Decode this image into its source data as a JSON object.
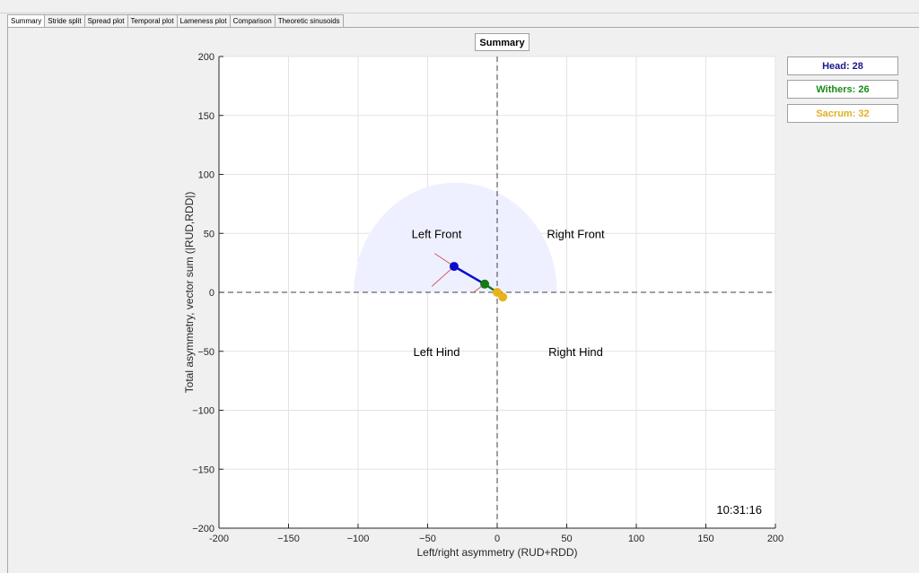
{
  "tabs": [
    {
      "label": "Summary",
      "active": true
    },
    {
      "label": "Stride split",
      "active": false
    },
    {
      "label": "Spread plot",
      "active": false
    },
    {
      "label": "Temporal plot",
      "active": false
    },
    {
      "label": "Lameness plot",
      "active": false
    },
    {
      "label": "Comparison",
      "active": false
    },
    {
      "label": "Theoretic sinusoids",
      "active": false
    }
  ],
  "summary_button": "Summary",
  "legend": [
    {
      "label": "Head: 28",
      "color": "#1a1a8a"
    },
    {
      "label": "Withers: 26",
      "color": "#1a8a1a"
    },
    {
      "label": "Sacrum: 32",
      "color": "#e0b020"
    }
  ],
  "chart_data": {
    "type": "scatter",
    "xlabel": "Left/right asymmetry (RUD+RDD)",
    "ylabel": "Total asymmetry, vector sum (|RUD,RDD|)",
    "xlim": [
      -200,
      200
    ],
    "ylim": [
      -200,
      200
    ],
    "xticks": [
      -200,
      -150,
      -100,
      -50,
      0,
      50,
      100,
      150,
      200
    ],
    "yticks": [
      -200,
      -150,
      -100,
      -50,
      0,
      50,
      100,
      150,
      200
    ],
    "xtick_labels": [
      "-200",
      "−150",
      "−100",
      "−50",
      "0",
      "50",
      "100",
      "150",
      "200"
    ],
    "ytick_labels": [
      "−200",
      "−150",
      "−100",
      "−50",
      "0",
      "50",
      "100",
      "150",
      "200"
    ],
    "grid": true,
    "quadrant_labels": [
      {
        "text": "Left Front",
        "x": -50,
        "y": 50
      },
      {
        "text": "Right Front",
        "x": 50,
        "y": 50
      },
      {
        "text": "Left Hind",
        "x": -50,
        "y": -50
      },
      {
        "text": "Right Hind",
        "x": 50,
        "y": -50
      }
    ],
    "timestamp": "10:31:16",
    "region": {
      "cx": -30,
      "cy": 0,
      "rx": 73,
      "ry": 93
    },
    "series": [
      {
        "name": "Head",
        "color": "#0d0dc8",
        "segment": [
          [
            -9,
            7
          ],
          [
            -31,
            22
          ]
        ],
        "point": [
          -31,
          22
        ]
      },
      {
        "name": "Withers",
        "color": "#137a13",
        "segment": [
          [
            0,
            0
          ],
          [
            -9,
            7
          ]
        ],
        "point": [
          -9,
          7
        ]
      },
      {
        "name": "Sacrum",
        "color": "#e8b21a",
        "segment": [
          [
            0,
            0
          ],
          [
            4,
            -4
          ]
        ],
        "point": [
          4,
          -4
        ]
      }
    ],
    "markers": [
      {
        "color": "#d06060",
        "from": [
          -31,
          22
        ],
        "to": [
          -45,
          33
        ]
      },
      {
        "color": "#d06060",
        "from": [
          -31,
          22
        ],
        "to": [
          -47,
          5
        ]
      },
      {
        "color": "#d06060",
        "from": [
          -9,
          7
        ],
        "to": [
          -17,
          0
        ]
      }
    ],
    "extra_points": [
      {
        "color": "#e8b21a",
        "point": [
          0,
          0
        ]
      }
    ]
  }
}
